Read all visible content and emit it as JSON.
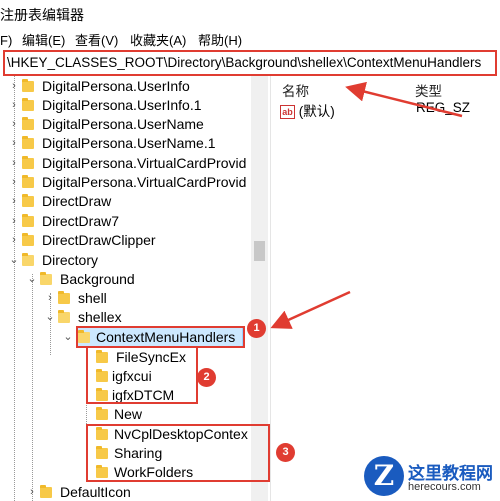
{
  "title": "注册表编辑器",
  "menu": [
    "F)",
    "编辑(E)",
    "查看(V)",
    "收藏夹(A)",
    "帮助(H)"
  ],
  "address": "\\HKEY_CLASSES_ROOT\\Directory\\Background\\shellex\\ContextMenuHandlers",
  "tree": [
    {
      "label": "DigitalPersona.UserInfo"
    },
    {
      "label": "DigitalPersona.UserInfo.1"
    },
    {
      "label": "DigitalPersona.UserName"
    },
    {
      "label": "DigitalPersona.UserName.1"
    },
    {
      "label": "DigitalPersona.VirtualCardProvid"
    },
    {
      "label": "DigitalPersona.VirtualCardProvid"
    },
    {
      "label": "DirectDraw"
    },
    {
      "label": "DirectDraw7"
    },
    {
      "label": "DirectDrawClipper"
    },
    {
      "label": "Directory"
    },
    {
      "label": "Background"
    },
    {
      "label": "shell"
    },
    {
      "label": "shellex"
    },
    {
      "label": "ContextMenuHandlers"
    },
    {
      "label": "FileSyncEx"
    },
    {
      "label": "igfxcui"
    },
    {
      "label": "igfxDTCM"
    },
    {
      "label": "New"
    },
    {
      "label": "NvCplDesktopContex"
    },
    {
      "label": "Sharing"
    },
    {
      "label": "WorkFolders"
    },
    {
      "label": "DefaultIcon"
    }
  ],
  "columns": {
    "name": "名称",
    "type": "类型"
  },
  "values": [
    {
      "name": "(默认)",
      "type": "REG_SZ",
      "icon": "ab"
    }
  ],
  "badges": [
    "1",
    "2",
    "3"
  ],
  "watermark": {
    "logo": "Z",
    "title": "这里教程网",
    "url": "herecours.com"
  },
  "colors": {
    "annotation": "#e03c31",
    "selection": "#cce8ff",
    "folder": "#f7c948"
  }
}
